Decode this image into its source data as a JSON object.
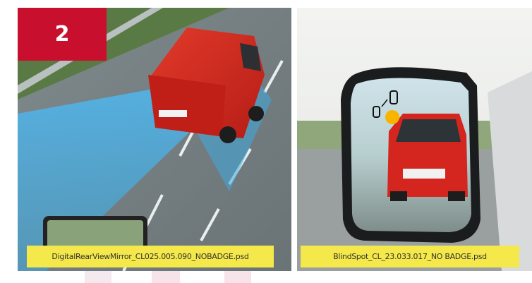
{
  "step": {
    "number": "2"
  },
  "panels": [
    {
      "caption": "DigitalRearViewMirror_CL025.005.090_NOBADGE.psd"
    },
    {
      "caption": "BlindSpot_CL_23.033.017_NO BADGE.psd"
    }
  ],
  "colors": {
    "badge": "#c8102e",
    "caption_bg": "#f5e84a",
    "van_red": "#d4261f",
    "sensor_blue": "#3fa9e0",
    "warning_amber": "#f7b500"
  }
}
